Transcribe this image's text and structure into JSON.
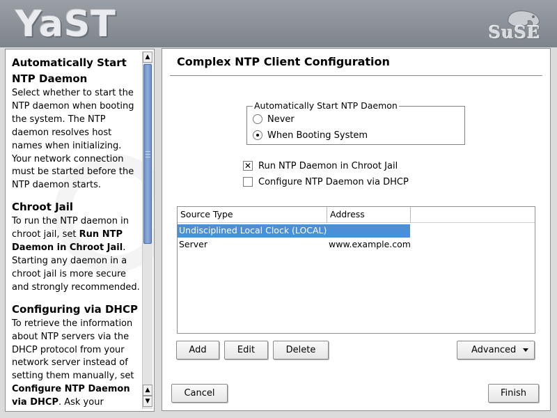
{
  "banner": {
    "app_logo_text": "YaST",
    "vendor_logo_text": "SuSE"
  },
  "help": {
    "sections": [
      {
        "heading": "Automatically Start NTP Daemon",
        "body": "Select whether to start the NTP daemon when booting the system. The NTP daemon resolves host names when initializing. Your network connection must be started before the NTP daemon starts."
      },
      {
        "heading": "Chroot Jail",
        "body_pre": "To run the NTP daemon in chroot jail, set ",
        "body_bold": "Run NTP Daemon in Chroot Jail",
        "body_post": ". Starting any daemon in a chroot jail is more secure and strongly recommended."
      },
      {
        "heading": "Configuring via DHCP",
        "body_pre": "To retrieve the information about NTP servers via the DHCP protocol from your network server instead of setting them manually, set ",
        "body_bold": "Configure NTP Daemon via DHCP",
        "body_post": ". Ask your network"
      }
    ]
  },
  "dialog": {
    "title": "Complex NTP Client Configuration",
    "start_group": {
      "legend": "Automatically Start NTP Daemon",
      "options": [
        {
          "label": "Never",
          "selected": false
        },
        {
          "label": "When Booting System",
          "selected": true
        }
      ]
    },
    "checkboxes": [
      {
        "label": "Run NTP Daemon in Chroot Jail",
        "checked": true
      },
      {
        "label": "Configure NTP Daemon via DHCP",
        "checked": false
      }
    ],
    "table": {
      "columns": [
        "Source Type",
        "Address"
      ],
      "rows": [
        {
          "source_type": "Undisciplined Local Clock (LOCAL)",
          "address": "",
          "selected": true
        },
        {
          "source_type": "Server",
          "address": "www.example.com",
          "selected": false
        }
      ]
    },
    "buttons": {
      "add": "Add",
      "edit": "Edit",
      "delete": "Delete",
      "advanced": "Advanced"
    },
    "footer": {
      "cancel": "Cancel",
      "finish": "Finish"
    }
  },
  "colors": {
    "selection": "#4a90d9",
    "banner": "#8a9097",
    "scrollbar_thumb": "#7f9fd2"
  }
}
